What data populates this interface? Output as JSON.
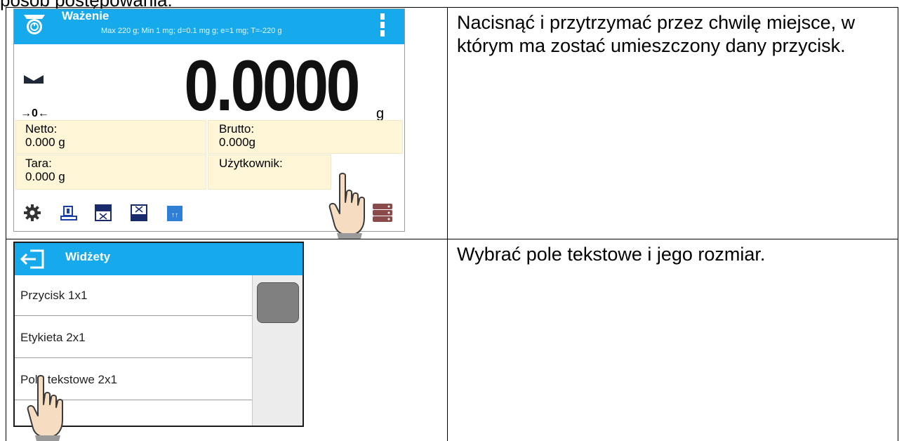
{
  "doc": {
    "heading_partial": "posób postępowania:",
    "steps": [
      {
        "instruction": "Nacisnąć i przytrzymać przez chwilę miejsce, w którym ma zostać umieszczony dany przycisk."
      },
      {
        "instruction": "Wybrać pole tekstowe i jego rozmiar."
      }
    ]
  },
  "weighing_screen": {
    "title": "Ważenie",
    "subtitle": "Max 220 g; Min 1 mg; d=0.1 mg g; e=1 mg; T=-220 g",
    "reading": "0.0000",
    "unit": "g",
    "zero_indicator": "→0←",
    "fields": {
      "net_label": "Netto:",
      "net_value": "0.000 g",
      "gross_label": "Brutto:",
      "gross_value": "0.000g",
      "tare_label": "Tara:",
      "tare_value": "0.000 g",
      "user_label": "Użytkownik:"
    },
    "toolbar": [
      "gear-icon",
      "weight-icon",
      "threshold-low-icon",
      "threshold-high-icon",
      "print-header-icon"
    ],
    "colors": {
      "header": "#16a9ec",
      "field_bg": "#fff6d8"
    }
  },
  "widgets_screen": {
    "title": "Widżety",
    "items": [
      "Przycisk 1x1",
      "Etykieta 2x1",
      "Pole tekstowe 2x1"
    ]
  }
}
